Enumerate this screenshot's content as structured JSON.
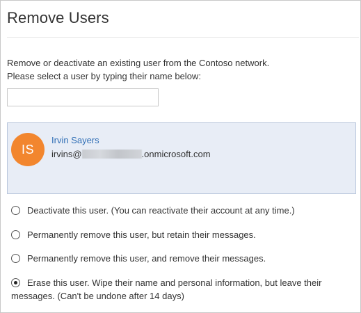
{
  "page": {
    "title": "Remove Users"
  },
  "description": {
    "line1": "Remove or deactivate an existing user from the Contoso  network.",
    "line2": "Please select a user by typing their name below:"
  },
  "search": {
    "value": "",
    "placeholder": ""
  },
  "selected_user": {
    "initials": "IS",
    "name": "Irvin Sayers",
    "email_prefix": "irvins@",
    "email_suffix": ".onmicrosoft.com",
    "avatar_color": "#f2862e",
    "name_color": "#2f6eb5",
    "card_background": "#e8edf6"
  },
  "options": [
    {
      "label": "Deactivate this user. (You can reactivate their account at any time.)",
      "checked": false
    },
    {
      "label": "Permanently remove this user, but retain their messages.",
      "checked": false
    },
    {
      "label": "Permanently remove this user, and remove their messages.",
      "checked": false
    },
    {
      "label_line1": "Erase this user. Wipe their name and personal information, but leave their",
      "label_line2": "messages. (Can't be undone after 14 days)",
      "checked": true
    }
  ]
}
